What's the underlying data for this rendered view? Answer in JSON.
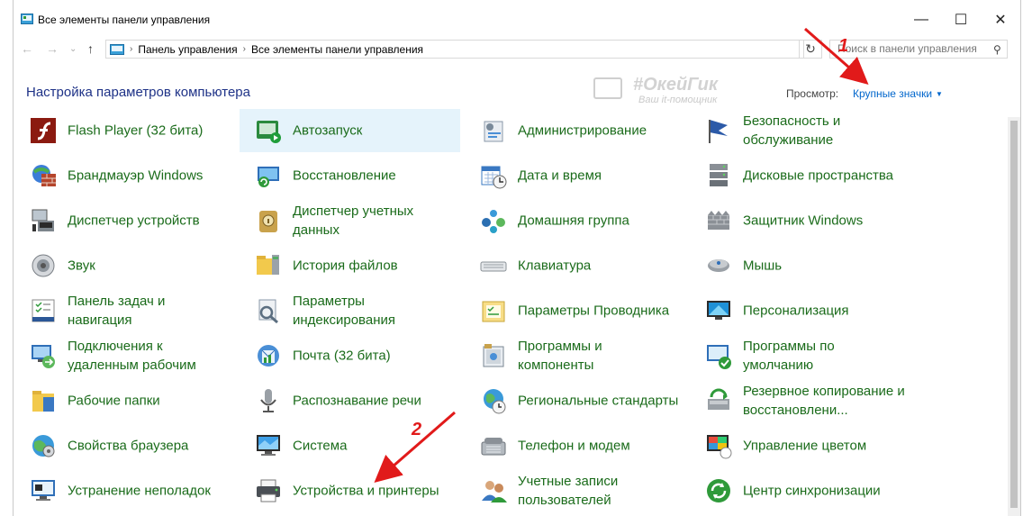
{
  "window": {
    "title": "Все элементы панели управления",
    "minimize": "—",
    "maximize": "☐",
    "close": "✕"
  },
  "address": {
    "back": "←",
    "forward": "→",
    "up": "↑",
    "crumb1": "Панель управления",
    "crumb2": "Все элементы панели управления",
    "refresh": "↻",
    "search_placeholder": "Поиск в панели управления"
  },
  "header": {
    "title": "Настройка параметров компьютера",
    "view_label": "Просмотр:",
    "view_value": "Крупные значки"
  },
  "watermark": {
    "line1": "#ОкейГик",
    "line2": "Ваш it-помощник"
  },
  "annotations": {
    "one": "1",
    "two": "2"
  },
  "items": [
    {
      "label": "Flash Player (32 бита)",
      "icon": "flash-icon",
      "col": 0,
      "row": 0
    },
    {
      "label": "Автозапуск",
      "icon": "autoplay-icon",
      "col": 1,
      "row": 0,
      "selected": true
    },
    {
      "label": "Администрирование",
      "icon": "admin-tools-icon",
      "col": 2,
      "row": 0
    },
    {
      "label": "Безопасность и обслуживание",
      "icon": "flag-icon",
      "col": 3,
      "row": 0
    },
    {
      "label": "Брандмауэр Windows",
      "icon": "firewall-icon",
      "col": 0,
      "row": 1
    },
    {
      "label": "Восстановление",
      "icon": "recovery-icon",
      "col": 1,
      "row": 1
    },
    {
      "label": "Дата и время",
      "icon": "calendar-icon",
      "col": 2,
      "row": 1
    },
    {
      "label": "Дисковые пространства",
      "icon": "storage-icon",
      "col": 3,
      "row": 1
    },
    {
      "label": "Диспетчер устройств",
      "icon": "device-manager-icon",
      "col": 0,
      "row": 2
    },
    {
      "label": "Диспетчер учетных данных",
      "icon": "credential-icon",
      "col": 1,
      "row": 2
    },
    {
      "label": "Домашняя группа",
      "icon": "homegroup-icon",
      "col": 2,
      "row": 2
    },
    {
      "label": "Защитник Windows",
      "icon": "defender-icon",
      "col": 3,
      "row": 2
    },
    {
      "label": "Звук",
      "icon": "speaker-icon",
      "col": 0,
      "row": 3
    },
    {
      "label": "История файлов",
      "icon": "file-history-icon",
      "col": 1,
      "row": 3
    },
    {
      "label": "Клавиатура",
      "icon": "keyboard-icon",
      "col": 2,
      "row": 3
    },
    {
      "label": "Мышь",
      "icon": "mouse-icon",
      "col": 3,
      "row": 3
    },
    {
      "label": "Панель задач и навигация",
      "icon": "taskbar-icon",
      "col": 0,
      "row": 4
    },
    {
      "label": "Параметры индексирования",
      "icon": "indexing-icon",
      "col": 1,
      "row": 4
    },
    {
      "label": "Параметры Проводника",
      "icon": "folder-options-icon",
      "col": 2,
      "row": 4
    },
    {
      "label": "Персонализация",
      "icon": "personalization-icon",
      "col": 3,
      "row": 4
    },
    {
      "label": "Подключения к удаленным рабочим",
      "icon": "remote-icon",
      "col": 0,
      "row": 5
    },
    {
      "label": "Почта (32 бита)",
      "icon": "mail-icon",
      "col": 1,
      "row": 5
    },
    {
      "label": "Программы и компоненты",
      "icon": "programs-icon",
      "col": 2,
      "row": 5
    },
    {
      "label": "Программы по умолчанию",
      "icon": "default-programs-icon",
      "col": 3,
      "row": 5
    },
    {
      "label": "Рабочие папки",
      "icon": "work-folders-icon",
      "col": 0,
      "row": 6
    },
    {
      "label": "Распознавание речи",
      "icon": "microphone-icon",
      "col": 1,
      "row": 6
    },
    {
      "label": "Региональные стандарты",
      "icon": "region-icon",
      "col": 2,
      "row": 6
    },
    {
      "label": "Резервное копирование и восстановлени...",
      "icon": "backup-icon",
      "col": 3,
      "row": 6
    },
    {
      "label": "Свойства браузера",
      "icon": "internet-options-icon",
      "col": 0,
      "row": 7
    },
    {
      "label": "Система",
      "icon": "system-icon",
      "col": 1,
      "row": 7
    },
    {
      "label": "Телефон и модем",
      "icon": "phone-icon",
      "col": 2,
      "row": 7
    },
    {
      "label": "Управление цветом",
      "icon": "color-management-icon",
      "col": 3,
      "row": 7
    },
    {
      "label": "Устранение неполадок",
      "icon": "troubleshooting-icon",
      "col": 0,
      "row": 8
    },
    {
      "label": "Устройства и принтеры",
      "icon": "printer-icon",
      "col": 1,
      "row": 8
    },
    {
      "label": "Учетные записи пользователей",
      "icon": "user-accounts-icon",
      "col": 2,
      "row": 8
    },
    {
      "label": "Центр синхронизации",
      "icon": "sync-center-icon",
      "col": 3,
      "row": 8
    }
  ]
}
